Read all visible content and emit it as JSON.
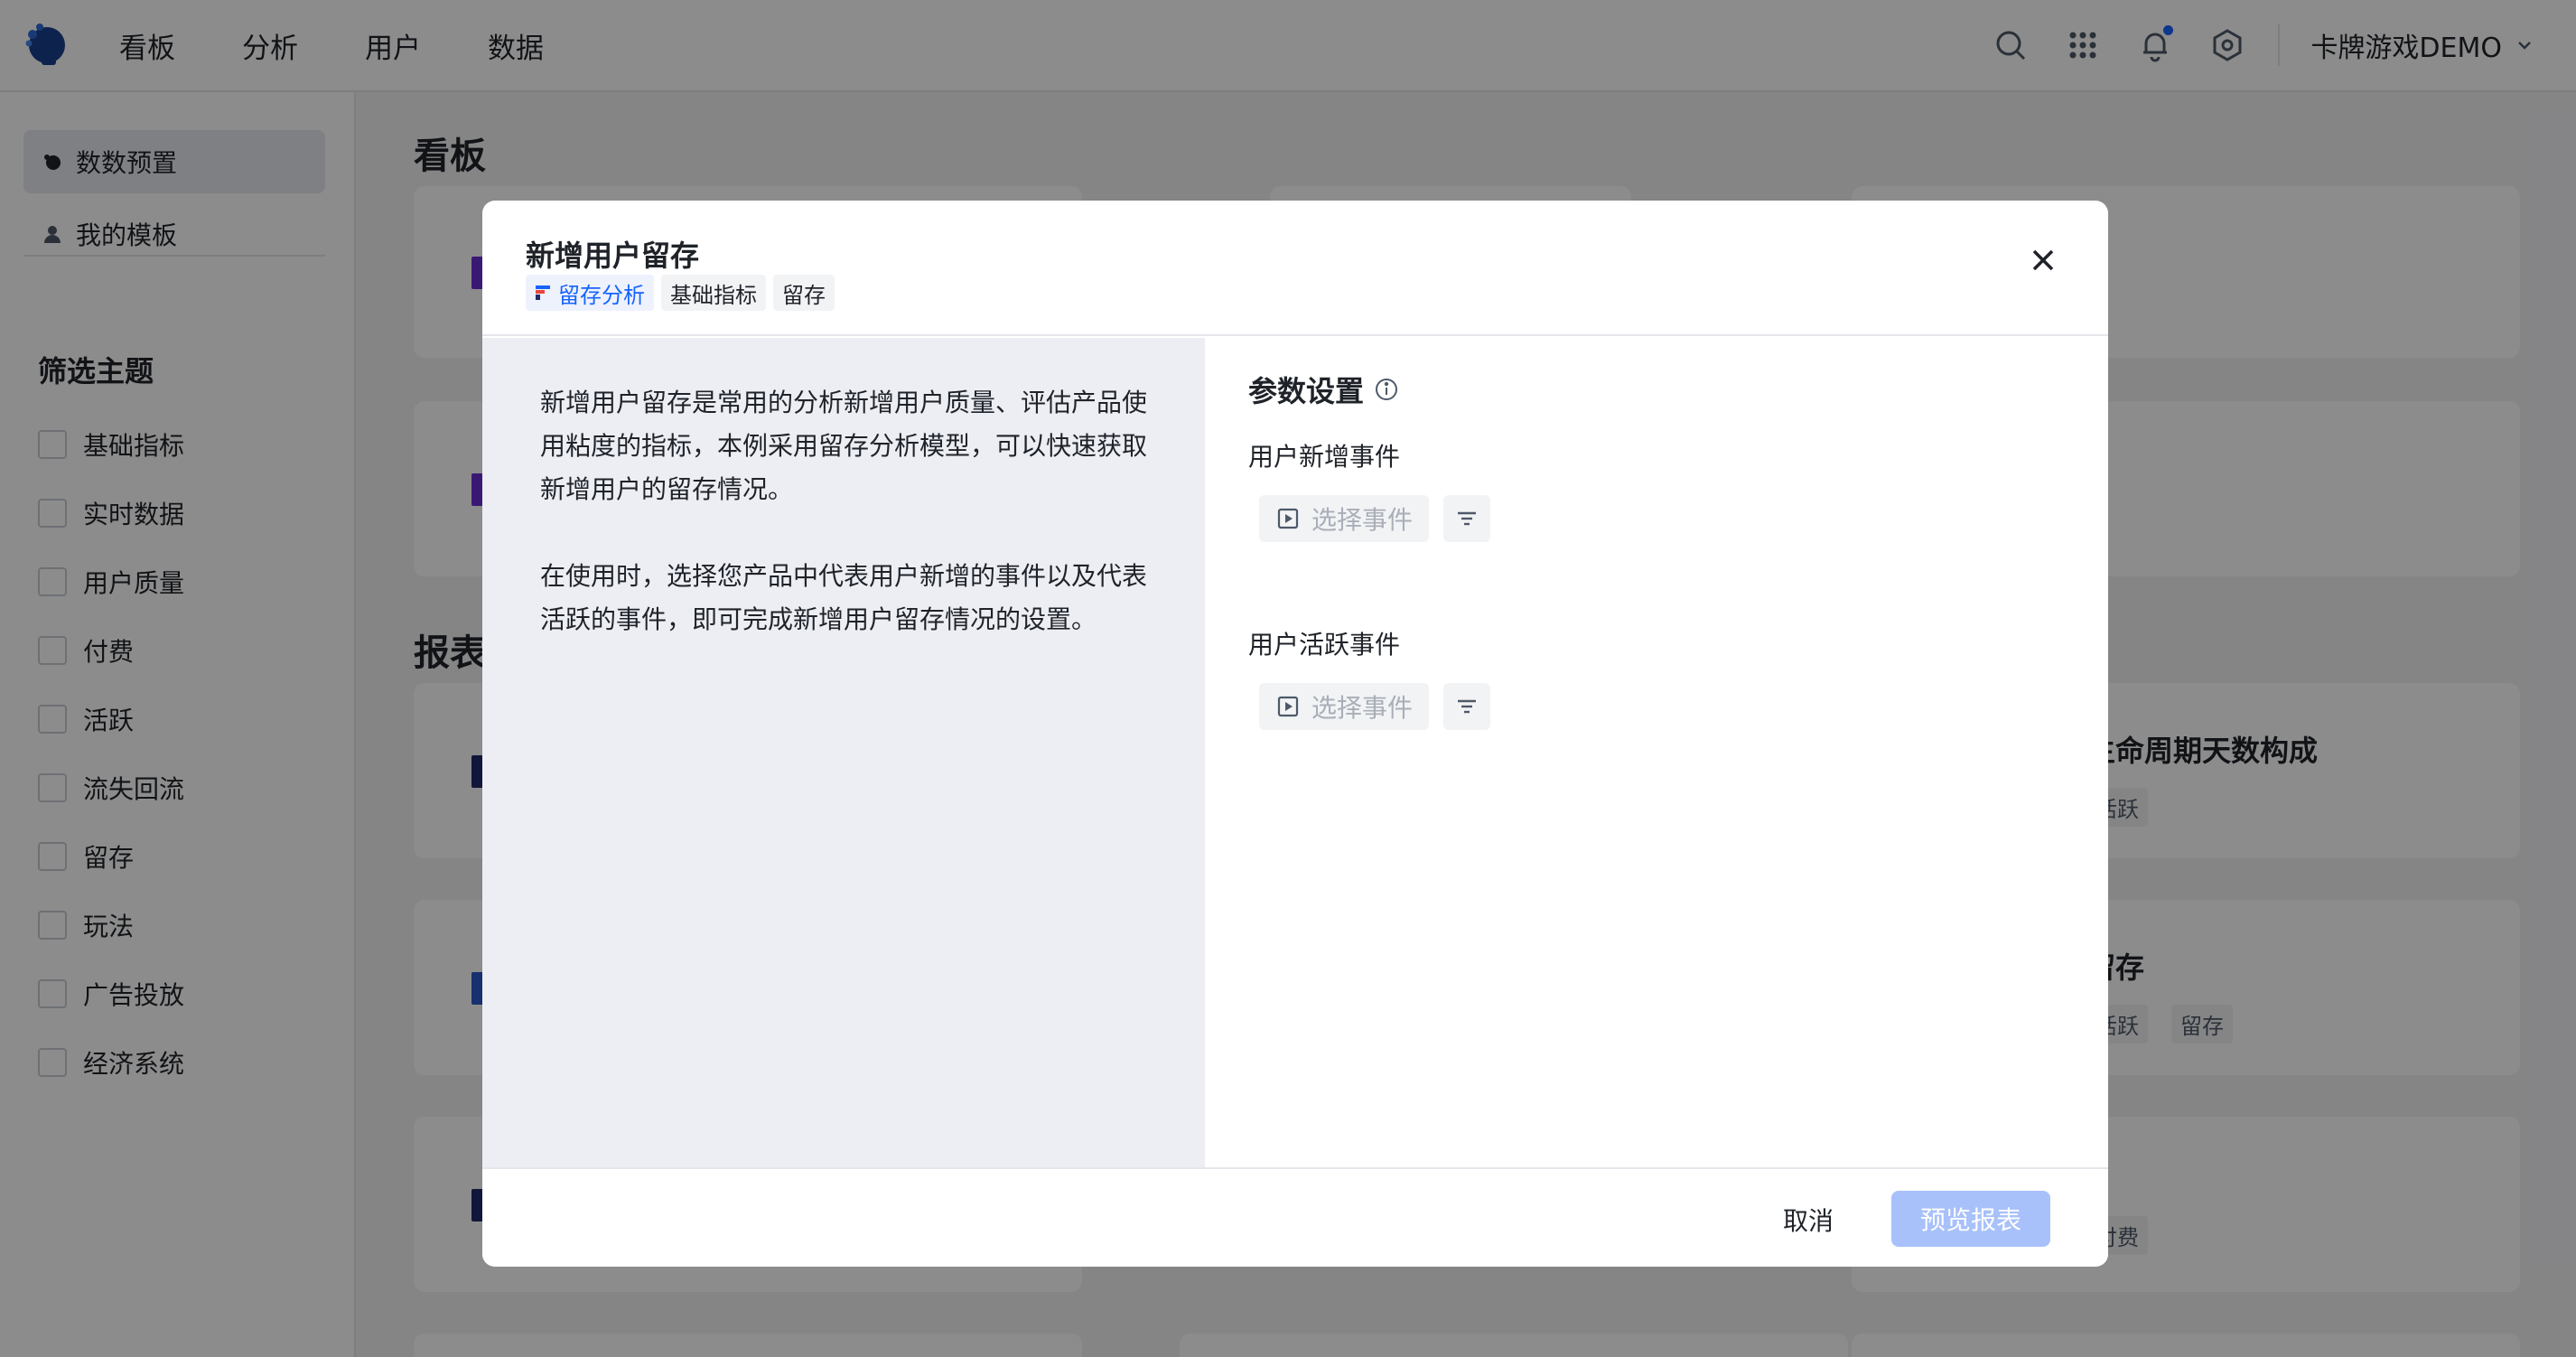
{
  "topbar": {
    "nav": [
      "看板",
      "分析",
      "用户",
      "数据"
    ],
    "icons": [
      "search-icon",
      "apps-grid-icon",
      "bell-icon",
      "settings-icon"
    ],
    "project_name": "卡牌游戏DEMO"
  },
  "sidebar": {
    "items": [
      {
        "label": "数数预置",
        "icon": "preset-icon",
        "active": true
      },
      {
        "label": "我的模板",
        "icon": "user-icon",
        "active": false
      }
    ],
    "filter_title": "筛选主题",
    "filters": [
      "基础指标",
      "实时数据",
      "用户质量",
      "付费",
      "活跃",
      "流失回流",
      "留存",
      "玩法",
      "广告投放",
      "经济系统"
    ]
  },
  "main": {
    "section_kanban": "看板",
    "section_report": "报表",
    "visible_cards": [
      {
        "title": "生命周期天数构成",
        "tags": [
          "活跃"
        ]
      },
      {
        "title": "留存",
        "tags": [
          "活跃",
          "留存"
        ]
      },
      {
        "title": "",
        "tags": [
          "付费"
        ]
      }
    ]
  },
  "modal": {
    "title": "新增用户留存",
    "tags": [
      {
        "label": "留存分析",
        "style": "blue"
      },
      {
        "label": "基础指标",
        "style": "gray"
      },
      {
        "label": "留存",
        "style": "gray"
      }
    ],
    "description": [
      "新增用户留存是常用的分析新增用户质量、评估产品使用粘度的指标，本例采用留存分析模型，可以快速获取新增用户的留存情况。",
      "在使用时，选择您产品中代表用户新增的事件以及代表活跃的事件，即可完成新增用户留存情况的设置。"
    ],
    "params_title": "参数设置",
    "fields": [
      {
        "label": "用户新增事件",
        "placeholder": "选择事件"
      },
      {
        "label": "用户活跃事件",
        "placeholder": "选择事件"
      }
    ],
    "cancel_label": "取消",
    "preview_label": "预览报表"
  },
  "colors": {
    "accent": "#1664ff",
    "preview_disabled": "#a8c1fb",
    "overlay": "rgba(0,0,0,0.45)"
  }
}
